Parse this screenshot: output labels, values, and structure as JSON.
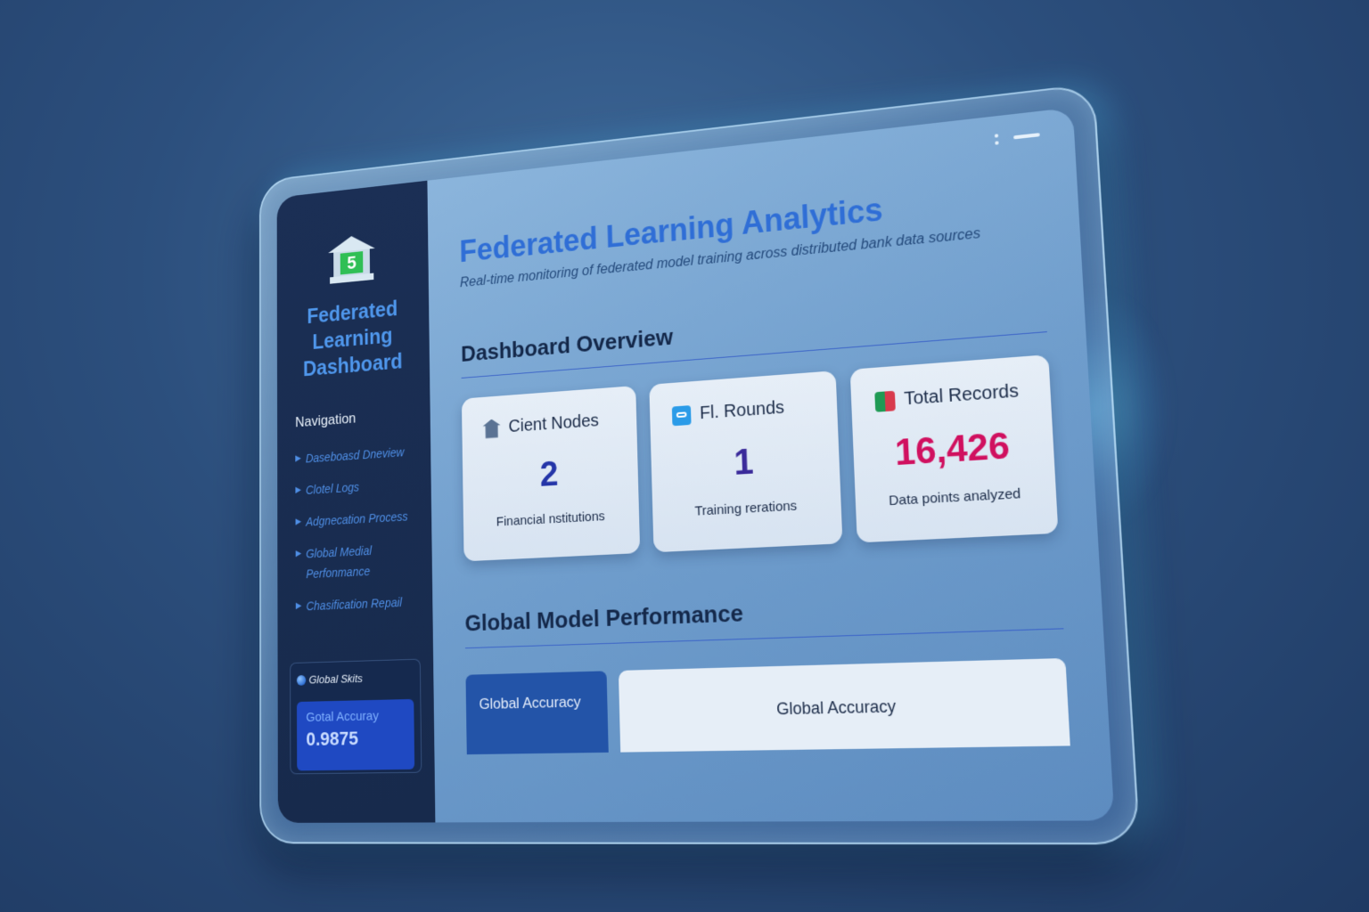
{
  "sidebar": {
    "logo_number": "5",
    "brand": "Federated Learning Dashboard",
    "nav_heading": "Navigation",
    "nav_items": [
      {
        "label": "Daseboasd Dneview"
      },
      {
        "label": "Clotel Logs"
      },
      {
        "label": "Adgnecation Process"
      },
      {
        "label": "Global Medial Perfonmance"
      },
      {
        "label": "Chasification Repail"
      }
    ],
    "stats": {
      "title": "Global Skits",
      "accuracy_label": "Gotal Accuray",
      "accuracy_value": "0.9875"
    }
  },
  "header": {
    "title": "Federated Learning Analytics",
    "subtitle": "Real-time monitoring of federated model training across distributed bank data sources"
  },
  "overview": {
    "heading": "Dashboard Overview",
    "cards": [
      {
        "icon": "bank-icon",
        "title": "Cient Nodes",
        "value": "2",
        "desc": "Financial nstitutions",
        "color": "#2435a8"
      },
      {
        "icon": "rounds-icon",
        "title": "Fl. Rounds",
        "value": "1",
        "desc": "Training rerations",
        "color": "#3a2a9a"
      },
      {
        "icon": "records-icon",
        "title": "Total Records",
        "value": "16,426",
        "desc": "Data points analyzed",
        "color": "#d0105f"
      }
    ]
  },
  "performance": {
    "heading": "Global Model Performance",
    "tab_label": "Global Accuracy",
    "panel_label": "Global Accuracy"
  },
  "colors": {
    "accent": "#2f6ed6",
    "sidebar_bg": "#1b2f55",
    "highlight_value": "#d0105f"
  }
}
